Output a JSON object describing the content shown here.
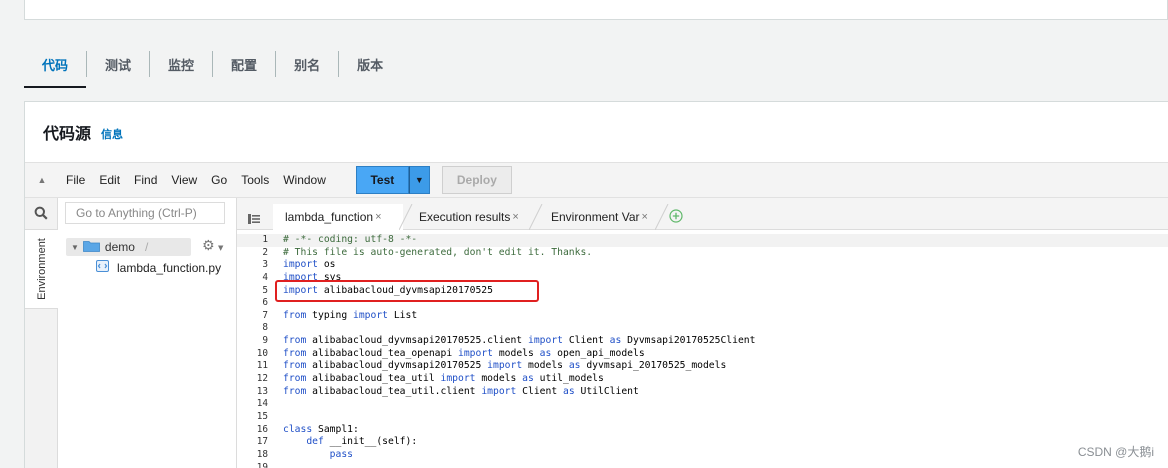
{
  "tabs": [
    {
      "label": "代码",
      "active": true
    },
    {
      "label": "测试"
    },
    {
      "label": "监控"
    },
    {
      "label": "配置"
    },
    {
      "label": "别名"
    },
    {
      "label": "版本"
    }
  ],
  "section": {
    "title": "代码源",
    "info": "信息"
  },
  "ide": {
    "menu": [
      "File",
      "Edit",
      "Find",
      "View",
      "Go",
      "Tools",
      "Window"
    ],
    "test_label": "Test",
    "deploy_label": "Deploy",
    "goto_placeholder": "Go to Anything (Ctrl-P)",
    "env_label": "Environment",
    "tree": {
      "folder": "demo",
      "slash": "/",
      "file": "lambda_function.py"
    },
    "editor_tabs": [
      {
        "label": "lambda_function",
        "active": true
      },
      {
        "label": "Execution results"
      },
      {
        "label": "Environment Var"
      }
    ],
    "code": {
      "line_numbers": [
        "1",
        "2",
        "3",
        "4",
        "5",
        "6",
        "7",
        "8",
        "9",
        "10",
        "11",
        "12",
        "13",
        "14",
        "15",
        "16",
        "17",
        "18",
        "19"
      ],
      "lines": [
        "# -*- coding: utf-8 -*-",
        "# This file is auto-generated, don't edit it. Thanks.",
        "import os",
        "import sys",
        "import alibabacloud_dyvmsapi20170525",
        "",
        "from typing import List",
        "",
        "from alibabacloud_dyvmsapi20170525.client import Client as Dyvmsapi20170525Client",
        "from alibabacloud_tea_openapi import models as open_api_models",
        "from alibabacloud_dyvmsapi20170525 import models as dyvmsapi_20170525_models",
        "from alibabacloud_tea_util import models as util_models",
        "from alibabacloud_tea_util.client import Client as UtilClient",
        "",
        "",
        "class Sampl1:",
        "    def __init__(self):",
        "        pass",
        ""
      ]
    }
  },
  "watermark": "CSDN @大鹅i",
  "colors": {
    "accent": "#0073bb",
    "test_button": "#49a7f5",
    "callout": "#e02020"
  }
}
